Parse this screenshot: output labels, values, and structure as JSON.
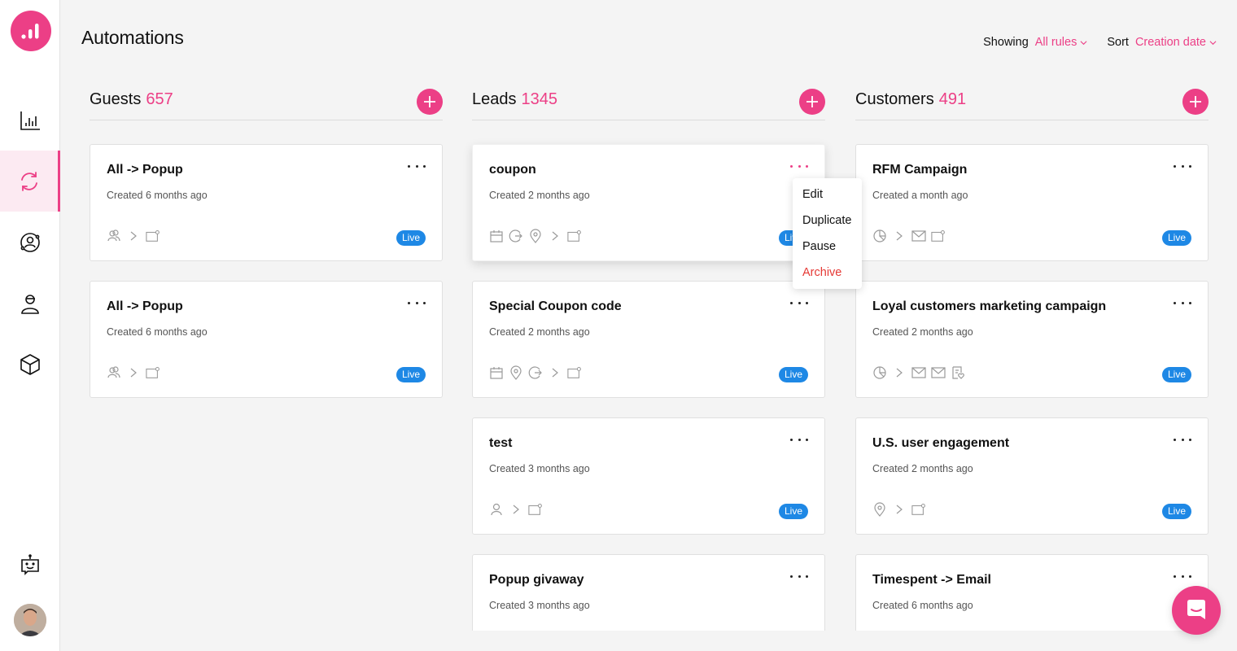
{
  "page": {
    "title": "Automations"
  },
  "filters": [
    {
      "label": "Showing",
      "value": "All rules"
    },
    {
      "label": "Sort",
      "value": "Creation date"
    }
  ],
  "colors": {
    "accent": "#ec3f86",
    "live": "#1e88e5",
    "danger": "#e53935"
  },
  "sidebar": {
    "logo": "bar-chart-logo",
    "items": [
      {
        "name": "analytics",
        "icon": "bar-chart-icon",
        "active": false
      },
      {
        "name": "automations",
        "icon": "sync-icon",
        "active": true
      },
      {
        "name": "audience",
        "icon": "user-circle-icon",
        "active": false
      },
      {
        "name": "contacts",
        "icon": "user-cap-icon",
        "active": false
      },
      {
        "name": "products",
        "icon": "cube-icon",
        "active": false
      },
      {
        "name": "bot",
        "icon": "robot-icon",
        "active": false
      }
    ]
  },
  "columns": [
    {
      "title": "Guests",
      "count": "657",
      "cards": [
        {
          "title": "All -> Popup",
          "created": "Created 6 months ago",
          "status": "Live",
          "flow": [
            "users",
            "arrow",
            "popup"
          ]
        },
        {
          "title": "All -> Popup",
          "created": "Created 6 months ago",
          "status": "Live",
          "flow": [
            "users",
            "arrow",
            "popup"
          ]
        }
      ]
    },
    {
      "title": "Leads",
      "count": "1345",
      "cards": [
        {
          "title": "coupon",
          "created": "Created 2 months ago",
          "status": "Live",
          "flow": [
            "calendar",
            "exit",
            "location",
            "arrow",
            "popup"
          ]
        },
        {
          "title": "Special Coupon code",
          "created": "Created 2 months ago",
          "status": "Live",
          "flow": [
            "calendar",
            "location",
            "exit",
            "arrow",
            "popup"
          ]
        },
        {
          "title": "test",
          "created": "Created 3 months ago",
          "status": "Live",
          "flow": [
            "user",
            "arrow",
            "popup"
          ]
        },
        {
          "title": "Popup givaway",
          "created": "Created 3 months ago",
          "status": "",
          "flow": []
        }
      ]
    },
    {
      "title": "Customers",
      "count": "491",
      "cards": [
        {
          "title": "RFM Campaign",
          "created": "Created a month ago",
          "status": "Live",
          "flow": [
            "segment",
            "arrow",
            "email",
            "popup"
          ]
        },
        {
          "title": "Loyal customers marketing campaign",
          "created": "Created 2 months ago",
          "status": "Live",
          "flow": [
            "segment",
            "arrow",
            "email",
            "email",
            "form"
          ]
        },
        {
          "title": "U.S. user engagement",
          "created": "Created 2 months ago",
          "status": "Live",
          "flow": [
            "location",
            "arrow",
            "popup"
          ]
        },
        {
          "title": "Timespent -> Email",
          "created": "Created 6 months ago",
          "status": "",
          "flow": []
        }
      ]
    }
  ],
  "context_menu": {
    "items": [
      {
        "label": "Edit",
        "danger": false
      },
      {
        "label": "Duplicate",
        "danger": false
      },
      {
        "label": "Pause",
        "danger": false
      },
      {
        "label": "Archive",
        "danger": true
      }
    ]
  }
}
